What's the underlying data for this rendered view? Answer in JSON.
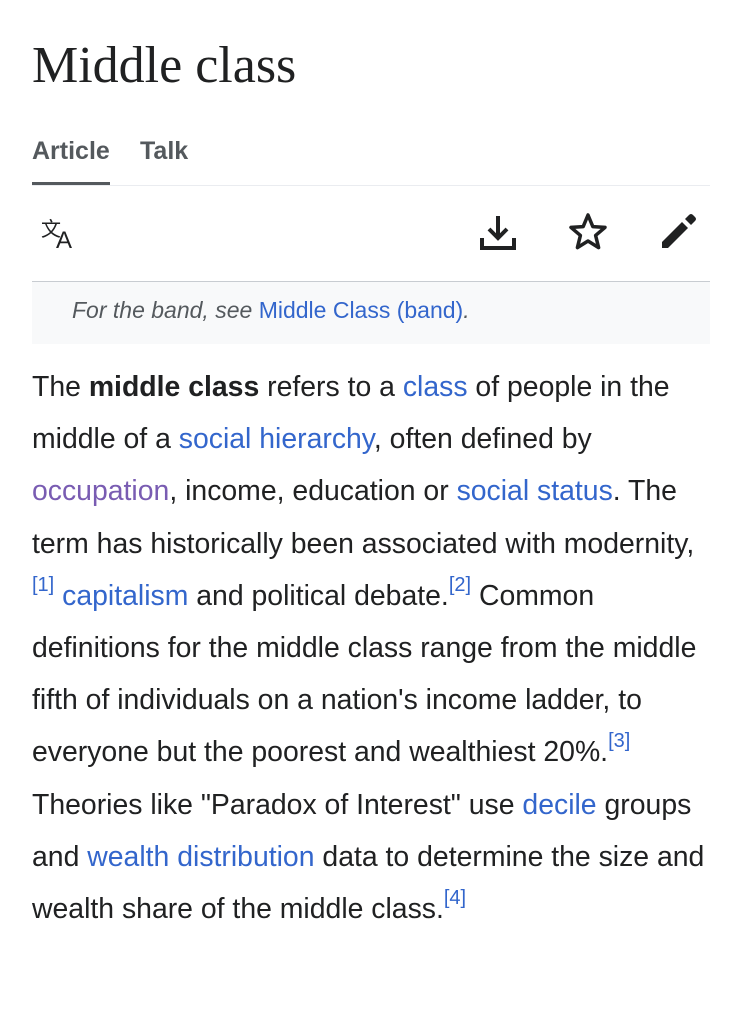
{
  "page": {
    "title": "Middle class"
  },
  "tabs": [
    {
      "label": "Article",
      "active": true
    },
    {
      "label": "Talk",
      "active": false
    }
  ],
  "toolbar": {
    "icons": [
      "language-icon",
      "download-icon",
      "star-icon",
      "edit-pencil-icon"
    ]
  },
  "hatnote": {
    "prefix": "For the band, see ",
    "link": "Middle Class (band)",
    "suffix": "."
  },
  "paragraph": {
    "t1": "The ",
    "bold": "middle class",
    "t2": " refers to a ",
    "link_class": "class",
    "t3": " of people in the middle of a ",
    "link_social_hierarchy": "social hierarchy",
    "t4": ", often defined by ",
    "link_occupation": "occupation",
    "t5": ", income, education or ",
    "link_social_status": "social status",
    "t6": ". The term has historically been associated with modernity,",
    "ref1": "[1]",
    "t7": " ",
    "link_capitalism": "capitalism",
    "t8": " and political debate.",
    "ref2": "[2]",
    "t9": " Common definitions for the middle class range from the middle fifth of individuals on a nation's income ladder, to everyone but the poorest and wealthiest 20%.",
    "ref3": "[3]",
    "t10": " Theories like \"Paradox of Interest\" use ",
    "link_decile": "decile",
    "t11": " groups and ",
    "link_wealth_distribution": "wealth distribution",
    "t12": " data to determine the size and wealth share of the middle class.",
    "ref4": "[4]"
  },
  "colors": {
    "link": "#3366cc",
    "visited_link": "#795cb2",
    "text": "#202122",
    "muted": "#54595d",
    "hatnote_bg": "#f8f9fa"
  }
}
